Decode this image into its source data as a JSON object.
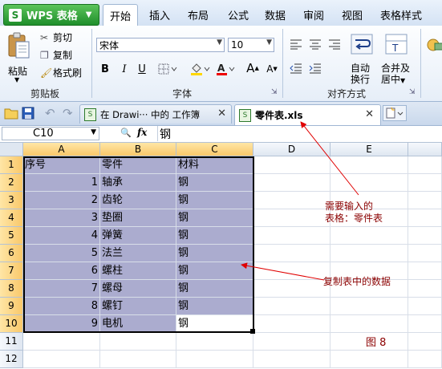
{
  "app": {
    "name": "WPS 表格"
  },
  "menu_tabs": [
    "开始",
    "插入",
    "布局",
    "公式",
    "数据",
    "审阅",
    "视图",
    "表格样式"
  ],
  "ribbon": {
    "clipboard": {
      "paste": "粘贴",
      "cut": "剪切",
      "copy": "复制",
      "format_painter": "格式刷",
      "label": "剪贴板"
    },
    "font": {
      "name": "宋体",
      "size": "10",
      "label": "字体",
      "bold": "B",
      "italic": "I",
      "underline": "U",
      "grow": "A",
      "shrink": "A"
    },
    "align": {
      "auto_wrap_1": "自动",
      "auto_wrap_2": "换行",
      "merge_1": "合并及",
      "merge_2": "居中",
      "label": "对齐方式"
    }
  },
  "doc_tabs": [
    {
      "label": "在 Drawi··· 中的 工作簿",
      "active": false
    },
    {
      "label": "零件表.xls",
      "active": true
    }
  ],
  "formula_bar": {
    "cell_ref": "C10",
    "fx": "fx",
    "value": "钢"
  },
  "columns": [
    "A",
    "B",
    "C",
    "D",
    "E"
  ],
  "rows": [
    "1",
    "2",
    "3",
    "4",
    "5",
    "6",
    "7",
    "8",
    "9",
    "10",
    "11",
    "12"
  ],
  "table": {
    "header": [
      "序号",
      "零件",
      "材料"
    ],
    "data": [
      [
        "1",
        "轴承",
        "钢"
      ],
      [
        "2",
        "齿轮",
        "钢"
      ],
      [
        "3",
        "垫圈",
        "钢"
      ],
      [
        "4",
        "弹簧",
        "钢"
      ],
      [
        "5",
        "法兰",
        "钢"
      ],
      [
        "6",
        "螺柱",
        "钢"
      ],
      [
        "7",
        "螺母",
        "钢"
      ],
      [
        "8",
        "螺钉",
        "钢"
      ],
      [
        "9",
        "电机",
        "钢"
      ]
    ]
  },
  "annotations": {
    "note1_line1": "需要输入的",
    "note1_line2": "表格：零件表",
    "note2": "复制表中的数据",
    "figure": "图 8"
  },
  "colors": {
    "selection": "#abaccf",
    "annotation": "#8b0000",
    "arrow": "#e00000"
  }
}
